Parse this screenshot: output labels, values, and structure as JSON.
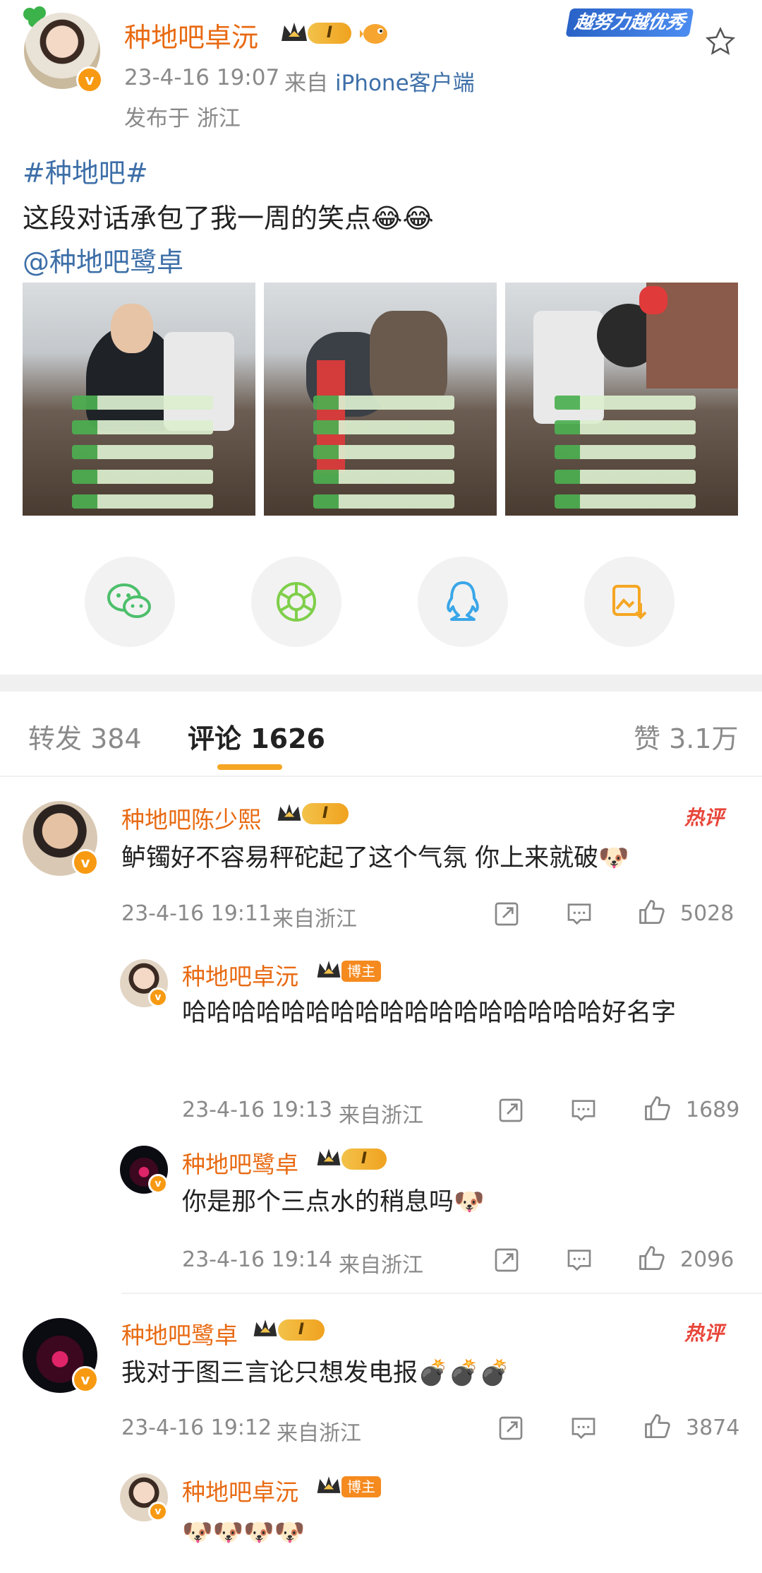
{
  "post": {
    "author": "种地吧卓沅",
    "level": "I",
    "time": "23-4-16 19:07",
    "from_prefix": "来自",
    "from_device": "iPhone客户端",
    "location": "发布于 浙江",
    "hashtag": "#种地吧#",
    "text": "这段对话承包了我一周的笑点",
    "emoji": "😂😂",
    "mention": "@种地吧鹭卓",
    "banner": "越努力越优秀"
  },
  "tabs": {
    "repost": "转发 384",
    "comment": "评论 1626",
    "like": "赞 3.1万"
  },
  "comments": [
    {
      "author": "种地吧陈少熙",
      "level": "I",
      "hot": "热评",
      "text": "鲈镯好不容易秤砣起了这个气氛 你上来就破",
      "emoji": "🐶",
      "time": "23-4-16 19:11",
      "from": "来自浙江",
      "likes": "5028"
    },
    {
      "author": "种地吧卓沅",
      "badge": "博主",
      "text": "哈哈哈哈哈哈哈哈哈哈哈哈哈哈哈哈哈好名字",
      "time": "23-4-16 19:13",
      "from": "来自浙江",
      "likes": "1689"
    },
    {
      "author": "种地吧鹭卓",
      "level": "I",
      "text": "你是那个三点水的稍息吗",
      "emoji": "🐶",
      "time": "23-4-16 19:14",
      "from": "来自浙江",
      "likes": "2096"
    },
    {
      "author": "种地吧鹭卓",
      "level": "I",
      "hot": "热评",
      "text": "我对于图三言论只想发电报",
      "emoji": "💣💣💣",
      "time": "23-4-16 19:12",
      "from": "来自浙江",
      "likes": "3874"
    },
    {
      "author": "种地吧卓沅",
      "badge": "博主",
      "emoji": "🐶🐶🐶🐶"
    }
  ],
  "colors": {
    "accent": "#e86a12",
    "link": "#3d6fa8",
    "hot": "#e8463a",
    "wechat": "#4cbf6b",
    "moments": "#7fcf4a",
    "qq": "#3aa6e8",
    "save": "#f5a623"
  },
  "icons": [
    "star-icon",
    "wechat-icon",
    "moments-icon",
    "qq-icon",
    "save-image-icon",
    "share-icon",
    "comment-icon",
    "like-icon",
    "crown-icon",
    "verified-icon"
  ]
}
